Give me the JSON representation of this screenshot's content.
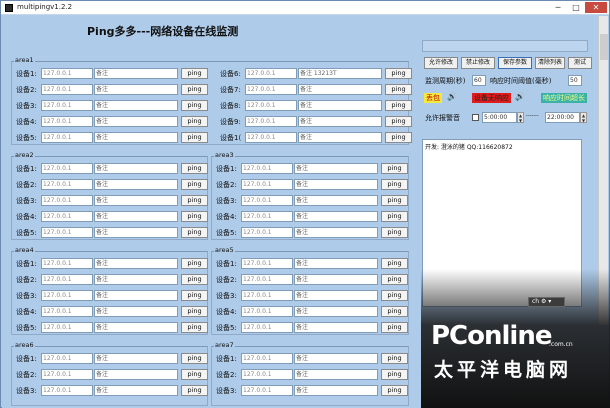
{
  "window": {
    "title": "multipingv1.2.2",
    "minimize": "─",
    "maximize": "□",
    "close": "✕"
  },
  "app_title": "Ping多多---网络设备在线监测",
  "ping_label": "ping",
  "areas": [
    {
      "title": "area1",
      "rows": [
        {
          "label": "设备1:",
          "ip": "127.0.0.1",
          "note": "备注"
        },
        {
          "label": "设备2:",
          "ip": "127.0.0.1",
          "note": "备注"
        },
        {
          "label": "设备3:",
          "ip": "127.0.0.1",
          "note": "备注"
        },
        {
          "label": "设备4:",
          "ip": "127.0.0.1",
          "note": "备注"
        },
        {
          "label": "设备5:",
          "ip": "127.0.0.1",
          "note": "备注"
        }
      ],
      "rows_right": [
        {
          "label": "设备6:",
          "ip": "127.0.0.1",
          "note": "备注 13213T"
        },
        {
          "label": "设备7:",
          "ip": "127.0.0.1",
          "note": "备注"
        },
        {
          "label": "设备8:",
          "ip": "127.0.0.1",
          "note": "备注"
        },
        {
          "label": "设备9:",
          "ip": "127.0.0.1",
          "note": "备注"
        },
        {
          "label": "设备1(",
          "ip": "127.0.0.1",
          "note": "备注"
        }
      ]
    },
    {
      "title": "area2",
      "rows": [
        {
          "label": "设备1:",
          "ip": "127.0.0.1",
          "note": "备注"
        },
        {
          "label": "设备2:",
          "ip": "127.0.0.1",
          "note": "备注"
        },
        {
          "label": "设备3:",
          "ip": "127.0.0.1",
          "note": "备注"
        },
        {
          "label": "设备4:",
          "ip": "127.0.0.1",
          "note": "备注"
        },
        {
          "label": "设备5:",
          "ip": "127.0.0.1",
          "note": "备注"
        }
      ]
    },
    {
      "title": "area3",
      "rows": [
        {
          "label": "设备1:",
          "ip": "127.0.0.1",
          "note": "备注"
        },
        {
          "label": "设备2:",
          "ip": "127.0.0.1",
          "note": "备注"
        },
        {
          "label": "设备3:",
          "ip": "127.0.0.1",
          "note": "备注"
        },
        {
          "label": "设备4:",
          "ip": "127.0.0.1",
          "note": "备注"
        },
        {
          "label": "设备5:",
          "ip": "127.0.0.1",
          "note": "备注"
        }
      ]
    },
    {
      "title": "area4",
      "rows": [
        {
          "label": "设备1:",
          "ip": "127.0.0.1",
          "note": "备注"
        },
        {
          "label": "设备2:",
          "ip": "127.0.0.1",
          "note": "备注"
        },
        {
          "label": "设备3:",
          "ip": "127.0.0.1",
          "note": "备注"
        },
        {
          "label": "设备4:",
          "ip": "127.0.0.1",
          "note": "备注"
        },
        {
          "label": "设备5:",
          "ip": "127.0.0.1",
          "note": "备注"
        }
      ]
    },
    {
      "title": "area5",
      "rows": [
        {
          "label": "设备1:",
          "ip": "127.0.0.1",
          "note": "备注"
        },
        {
          "label": "设备2:",
          "ip": "127.0.0.1",
          "note": "备注"
        },
        {
          "label": "设备3:",
          "ip": "127.0.0.1",
          "note": "备注"
        },
        {
          "label": "设备4:",
          "ip": "127.0.0.1",
          "note": "备注"
        },
        {
          "label": "设备5:",
          "ip": "127.0.0.1",
          "note": "备注"
        }
      ]
    },
    {
      "title": "area6",
      "rows": [
        {
          "label": "设备1:",
          "ip": "127.0.0.1",
          "note": "备注"
        },
        {
          "label": "设备2:",
          "ip": "127.0.0.1",
          "note": "备注"
        },
        {
          "label": "设备3:",
          "ip": "127.0.0.1",
          "note": "备注"
        }
      ]
    },
    {
      "title": "area7",
      "rows": [
        {
          "label": "设备1:",
          "ip": "127.0.0.1",
          "note": "备注"
        },
        {
          "label": "设备2:",
          "ip": "127.0.0.1",
          "note": "备注"
        },
        {
          "label": "设备3:",
          "ip": "127.0.0.1",
          "note": "备注"
        }
      ]
    }
  ],
  "controls": {
    "buttons": [
      "允许修改",
      "禁止修改",
      "保存参数",
      "清除列表",
      "测试"
    ],
    "period_label": "监测周期(秒)",
    "period_value": "60",
    "threshold_label": "响应时间阈值(毫秒)",
    "threshold_value": "50",
    "tag_lost": "丢包",
    "tag_down": "设备无响应",
    "tag_timeout": "响应时间超长",
    "speaker_icon": "🔊",
    "alarm_label": "允许报警音",
    "time_start": "5:00:00",
    "time_sep": "-------",
    "time_end": "22:00:00"
  },
  "log": {
    "text": "开发: 澄泳的猪 QQ:116620872"
  },
  "ime": {
    "text": "ch ⚙ ▾"
  },
  "watermark": {
    "brand": "PConline",
    "domain": ".com.cn",
    "cn": "太平洋电脑网"
  }
}
